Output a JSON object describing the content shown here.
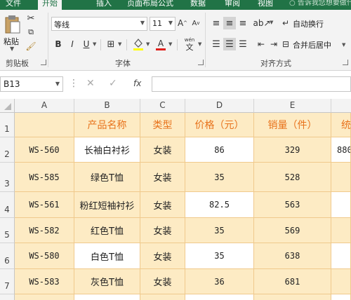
{
  "ribbon": {
    "tabs": [
      "文件",
      "开始",
      "插入",
      "页面布局",
      "公式",
      "数据",
      "审阅",
      "视图"
    ],
    "tell_me": "告诉我您想要做什么",
    "clipboard": {
      "paste_label": "粘贴",
      "group_label": "剪贴板"
    },
    "font": {
      "name": "等线",
      "size": "11",
      "bold": "B",
      "italic": "I",
      "underline": "U",
      "grow": "A",
      "shrink": "A",
      "wen": "wén",
      "wen2": "文",
      "font_color": "A",
      "group_label": "字体"
    },
    "alignment": {
      "wrap_text": "自动换行",
      "merge_center": "合并后居中",
      "group_label": "对齐方式"
    }
  },
  "formula_bar": {
    "name_box": "B13",
    "fx": "fx",
    "content": ""
  },
  "columns": [
    "A",
    "B",
    "C",
    "D",
    "E"
  ],
  "rows": [
    "1",
    "2",
    "3",
    "4",
    "5",
    "6",
    "7"
  ],
  "table": {
    "headers": [
      "产品名称",
      "类型",
      "价格（元）",
      "销量（件）",
      "统"
    ],
    "rows": [
      {
        "code": "WS-560",
        "name": "长袖白衬衫",
        "type": "女装",
        "price": "86",
        "sales": "329",
        "extra": "880"
      },
      {
        "code": "WS-585",
        "name": "绿色T恤",
        "type": "女装",
        "price": "35",
        "sales": "528",
        "extra": ""
      },
      {
        "code": "WS-561",
        "name": "粉红短袖衬衫",
        "type": "女装",
        "price": "82.5",
        "sales": "563",
        "extra": ""
      },
      {
        "code": "WS-582",
        "name": "红色T恤",
        "type": "女装",
        "price": "35",
        "sales": "569",
        "extra": ""
      },
      {
        "code": "WS-580",
        "name": "白色T恤",
        "type": "女装",
        "price": "35",
        "sales": "638",
        "extra": ""
      },
      {
        "code": "WS-583",
        "name": "灰色T恤",
        "type": "女装",
        "price": "36",
        "sales": "681",
        "extra": ""
      }
    ]
  },
  "colors": {
    "ribbon_green": "#217346",
    "header_orange": "#e8731c",
    "tan_fill": "#fdebc4",
    "border": "#f0c98c"
  }
}
